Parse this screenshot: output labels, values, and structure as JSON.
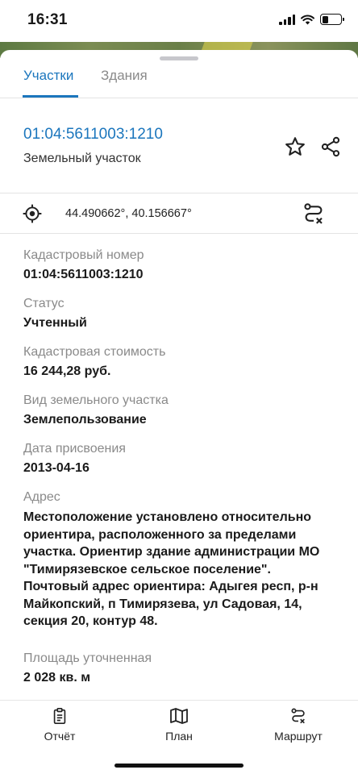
{
  "status_bar": {
    "time": "16:31",
    "battery_level": 0.35
  },
  "tabs": [
    {
      "label": "Участки",
      "active": true
    },
    {
      "label": "Здания",
      "active": false
    }
  ],
  "parcel": {
    "cadastral_link": "01:04:5611003:1210",
    "type": "Земельный участок",
    "coordinates": "44.490662°, 40.156667°"
  },
  "properties": [
    {
      "label": "Кадастровый номер",
      "value": "01:04:5611003:1210"
    },
    {
      "label": "Статус",
      "value": "Учтенный"
    },
    {
      "label": "Кадастровая стоимость",
      "value": "16 244,28 руб."
    },
    {
      "label": "Вид земельного участка",
      "value": "Землепользование"
    },
    {
      "label": "Дата присвоения",
      "value": "2013-04-16"
    },
    {
      "label": "Адрес",
      "value": "Местоположение установлено относительно ориентира, расположенного за пределами участка. Ориентир здание администрации МО \"Тимирязевское сельское поселение\". Почтовый адрес ориентира: Адыгея респ, р-н Майкопский, п Тимирязева, ул Садовая, 14, секция 20, контур 48."
    },
    {
      "label": "Площадь уточненная",
      "value": "2 028 кв. м"
    }
  ],
  "bottom_nav": [
    {
      "label": "Отчёт",
      "icon": "report-icon"
    },
    {
      "label": "План",
      "icon": "map-icon"
    },
    {
      "label": "Маршрут",
      "icon": "route-icon"
    }
  ],
  "colors": {
    "accent": "#1b76bd",
    "label_gray": "#8a8a8a"
  }
}
